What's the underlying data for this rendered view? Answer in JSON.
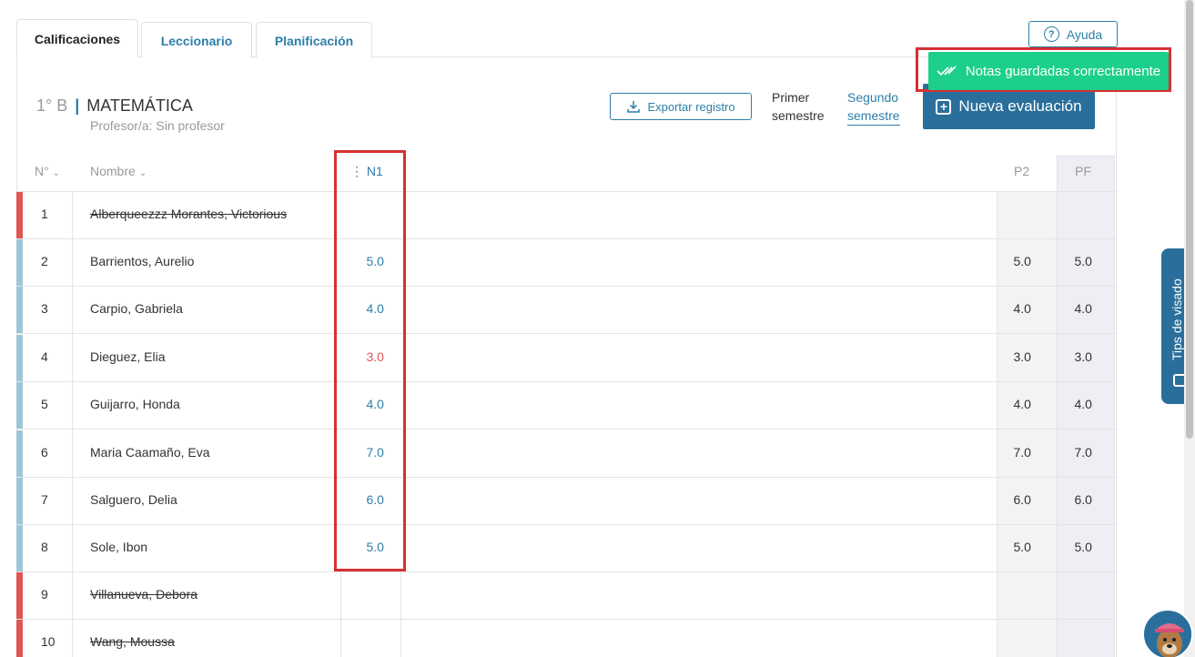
{
  "tabs": [
    {
      "label": "Calificaciones"
    },
    {
      "label": "Leccionario"
    },
    {
      "label": "Planificación"
    }
  ],
  "help": {
    "label": "Ayuda"
  },
  "toast": {
    "message": "Notas guardadas correctamente"
  },
  "course": {
    "grade": "1° B",
    "subject": "MATEMÁTICA",
    "teacher": "Profesor/a: Sin profesor"
  },
  "toolbar": {
    "export_label": "Exportar registro",
    "semester1_line1": "Primer",
    "semester1_line2": "semestre",
    "semester2_line1": "Segundo",
    "semester2_line2": "semestre",
    "new_eval_label": "Nueva evaluación"
  },
  "table": {
    "headers": {
      "num": "N°",
      "name": "Nombre",
      "n1": "N1",
      "p2": "P2",
      "pf": "PF"
    },
    "rows": [
      {
        "num": "1",
        "name": "Alberqueezzz Morantes, Victorious",
        "n1": "",
        "p2": "",
        "pf": "",
        "retired": true
      },
      {
        "num": "2",
        "name": "Barrientos, Aurelio",
        "n1": "5.0",
        "p2": "5.0",
        "pf": "5.0",
        "retired": false
      },
      {
        "num": "3",
        "name": "Carpio, Gabriela",
        "n1": "4.0",
        "p2": "4.0",
        "pf": "4.0",
        "retired": false
      },
      {
        "num": "4",
        "name": "Dieguez, Elia",
        "n1": "3.0",
        "p2": "3.0",
        "pf": "3.0",
        "retired": false
      },
      {
        "num": "5",
        "name": "Guijarro, Honda",
        "n1": "4.0",
        "p2": "4.0",
        "pf": "4.0",
        "retired": false
      },
      {
        "num": "6",
        "name": "Maria Caamaño, Eva",
        "n1": "7.0",
        "p2": "7.0",
        "pf": "7.0",
        "retired": false
      },
      {
        "num": "7",
        "name": "Salguero, Delia",
        "n1": "6.0",
        "p2": "6.0",
        "pf": "6.0",
        "retired": false
      },
      {
        "num": "8",
        "name": "Sole, Ibon",
        "n1": "5.0",
        "p2": "5.0",
        "pf": "5.0",
        "retired": false
      },
      {
        "num": "9",
        "name": "Villanueva, Debora",
        "n1": "",
        "p2": "",
        "pf": "",
        "retired": true
      },
      {
        "num": "10",
        "name": "Wang, Moussa",
        "n1": "",
        "p2": "",
        "pf": "",
        "retired": true
      }
    ]
  },
  "tips": {
    "label": "Tips de visado"
  },
  "colors": {
    "primary": "#2a6f9b",
    "link": "#2d7fa8",
    "success": "#1ccf8a",
    "retired_bar": "#e05555",
    "active_bar": "#9fc6d8",
    "failing": "#e05555",
    "highlight": "#d63031"
  }
}
